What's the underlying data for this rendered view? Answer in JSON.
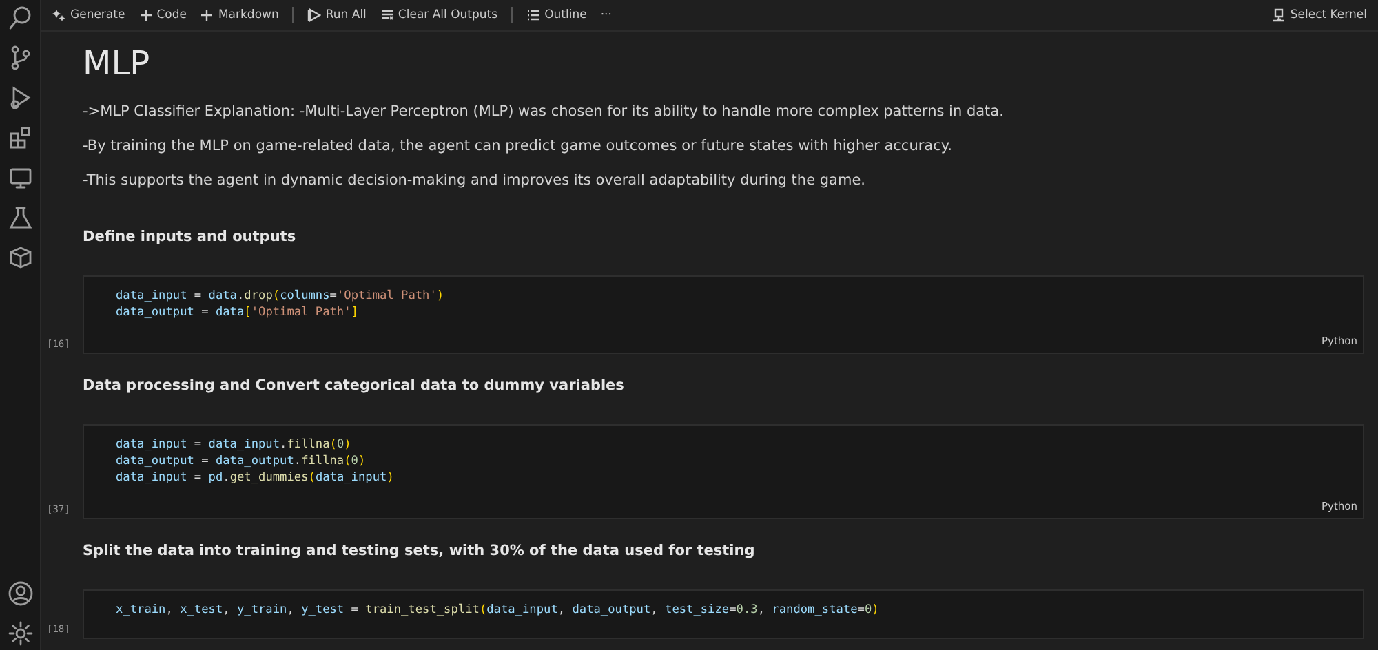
{
  "toolbar": {
    "items": [
      {
        "kind": "sparkle",
        "label": "Generate"
      },
      {
        "kind": "plus",
        "label": "Code"
      },
      {
        "kind": "plus",
        "label": "Markdown"
      },
      {
        "kind": "divider"
      },
      {
        "kind": "run",
        "label": "Run All"
      },
      {
        "kind": "clear",
        "label": "Clear All Outputs"
      },
      {
        "kind": "divider"
      },
      {
        "kind": "outline",
        "label": "Outline"
      },
      {
        "kind": "more",
        "label": "···"
      }
    ],
    "kernel": "Select Kernel"
  },
  "cells": [
    {
      "kind": "title",
      "text": "MLP"
    },
    {
      "kind": "para",
      "text": "->MLP Classifier Explanation: -Multi-Layer Perceptron (MLP) was chosen for its ability to handle more complex patterns in data."
    },
    {
      "kind": "para",
      "text": "-By training the MLP on game-related data, the agent can predict game outcomes or future states with higher accuracy."
    },
    {
      "kind": "para",
      "text": "-This supports the agent in dynamic decision-making and improves its overall adaptability during the game."
    },
    {
      "kind": "heading",
      "text": "Define inputs and outputs"
    },
    {
      "kind": "code",
      "count": "[16]",
      "language": "Python",
      "lines": [
        [
          {
            "kind": "var",
            "text": "data_input"
          },
          {
            "kind": "plain",
            "text": " = "
          },
          {
            "kind": "var",
            "text": "data"
          },
          {
            "kind": "plain",
            "text": "."
          },
          {
            "kind": "func",
            "text": "drop"
          },
          {
            "kind": "paren",
            "text": "("
          },
          {
            "kind": "var",
            "text": "columns"
          },
          {
            "kind": "plain",
            "text": "="
          },
          {
            "kind": "str",
            "text": "'Optimal Path'"
          },
          {
            "kind": "paren",
            "text": ")"
          }
        ],
        [
          {
            "kind": "var",
            "text": "data_output"
          },
          {
            "kind": "plain",
            "text": " = "
          },
          {
            "kind": "var",
            "text": "data"
          },
          {
            "kind": "paren",
            "text": "["
          },
          {
            "kind": "str",
            "text": "'Optimal Path'"
          },
          {
            "kind": "paren",
            "text": "]"
          }
        ]
      ]
    },
    {
      "kind": "heading",
      "text": "Data processing and Convert categorical data to dummy variables"
    },
    {
      "kind": "code",
      "count": "[37]",
      "language": "Python",
      "lines": [
        [
          {
            "kind": "var",
            "text": "data_input"
          },
          {
            "kind": "plain",
            "text": " = "
          },
          {
            "kind": "var",
            "text": "data_input"
          },
          {
            "kind": "plain",
            "text": "."
          },
          {
            "kind": "func",
            "text": "fillna"
          },
          {
            "kind": "paren",
            "text": "("
          },
          {
            "kind": "num",
            "text": "0"
          },
          {
            "kind": "paren",
            "text": ")"
          }
        ],
        [
          {
            "kind": "var",
            "text": "data_output"
          },
          {
            "kind": "plain",
            "text": " = "
          },
          {
            "kind": "var",
            "text": "data_output"
          },
          {
            "kind": "plain",
            "text": "."
          },
          {
            "kind": "func",
            "text": "fillna"
          },
          {
            "kind": "paren",
            "text": "("
          },
          {
            "kind": "num",
            "text": "0"
          },
          {
            "kind": "paren",
            "text": ")"
          }
        ],
        [
          {
            "kind": "var",
            "text": "data_input"
          },
          {
            "kind": "plain",
            "text": " = "
          },
          {
            "kind": "var",
            "text": "pd"
          },
          {
            "kind": "plain",
            "text": "."
          },
          {
            "kind": "func",
            "text": "get_dummies"
          },
          {
            "kind": "paren",
            "text": "("
          },
          {
            "kind": "var",
            "text": "data_input"
          },
          {
            "kind": "paren",
            "text": ")"
          }
        ]
      ]
    },
    {
      "kind": "heading",
      "text": "Split the data into training and testing sets, with 30% of the data used for testing"
    },
    {
      "kind": "code",
      "count": "[18]",
      "lines": [
        [
          {
            "kind": "var",
            "text": "x_train"
          },
          {
            "kind": "plain",
            "text": ", "
          },
          {
            "kind": "var",
            "text": "x_test"
          },
          {
            "kind": "plain",
            "text": ", "
          },
          {
            "kind": "var",
            "text": "y_train"
          },
          {
            "kind": "plain",
            "text": ", "
          },
          {
            "kind": "var",
            "text": "y_test"
          },
          {
            "kind": "plain",
            "text": " = "
          },
          {
            "kind": "func",
            "text": "train_test_split"
          },
          {
            "kind": "paren",
            "text": "("
          },
          {
            "kind": "var",
            "text": "data_input"
          },
          {
            "kind": "plain",
            "text": ", "
          },
          {
            "kind": "var",
            "text": "data_output"
          },
          {
            "kind": "plain",
            "text": ", "
          },
          {
            "kind": "var",
            "text": "test_size"
          },
          {
            "kind": "plain",
            "text": "="
          },
          {
            "kind": "num",
            "text": "0.3"
          },
          {
            "kind": "plain",
            "text": ", "
          },
          {
            "kind": "var",
            "text": "random_state"
          },
          {
            "kind": "plain",
            "text": "="
          },
          {
            "kind": "num",
            "text": "0"
          },
          {
            "kind": "paren",
            "text": ")"
          }
        ]
      ]
    }
  ]
}
